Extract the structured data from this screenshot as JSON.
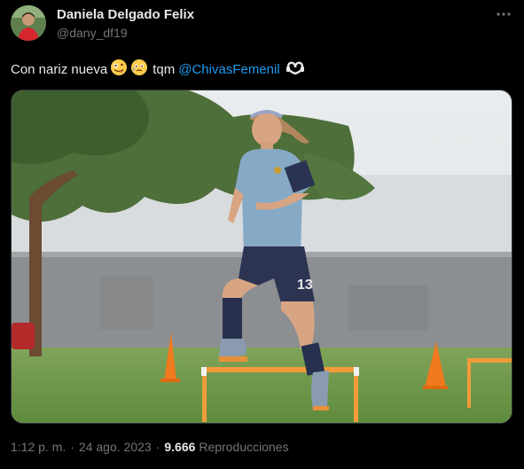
{
  "user": {
    "display_name": "Daniela Delgado Felix",
    "handle": "@dany_df19",
    "avatar_icon": "profile-photo"
  },
  "tweet": {
    "text": "Con nariz nueva",
    "emojis": [
      "zany-face-emoji",
      "holding-back-tears-emoji"
    ],
    "middle_text": "tqm",
    "mention": "@ChivasFemenil",
    "end_icon": "heart-hands-emoji",
    "media": {
      "description_icon": "photo-player-jumping-hurdles",
      "jersey_number": "13"
    }
  },
  "meta": {
    "time": "1:12 p. m.",
    "separator": "·",
    "date": "24 ago. 2023",
    "views_count": "9.666",
    "views_label": "Reproducciones"
  },
  "colors": {
    "background": "#000000",
    "text": "#e7e9ea",
    "muted": "#71767b",
    "link": "#1d9bf0"
  }
}
